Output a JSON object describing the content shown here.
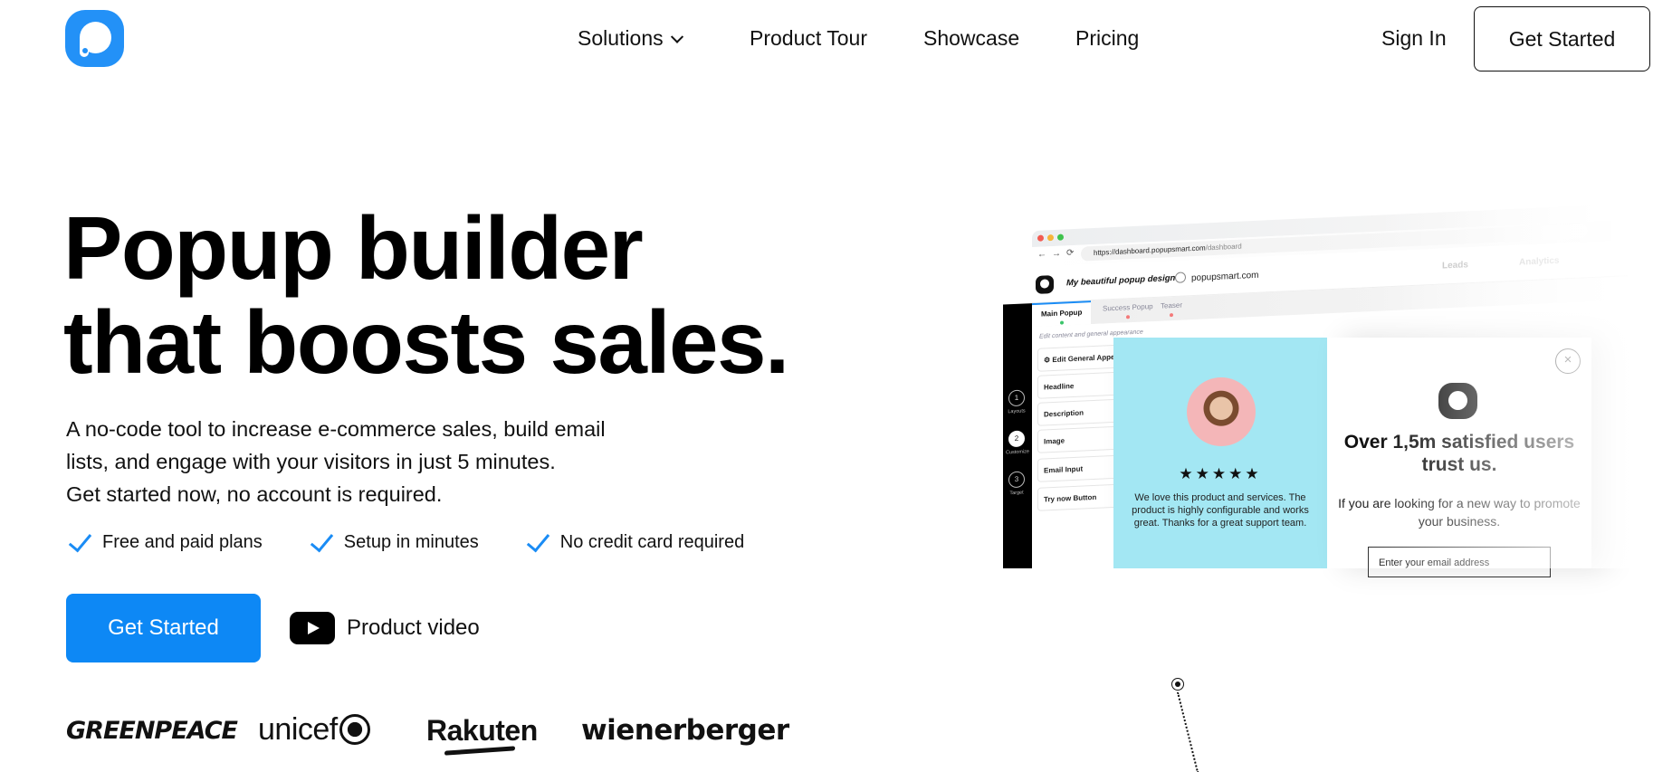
{
  "header": {
    "logo_alt": "Popupsmart",
    "nav": [
      {
        "label": "Solutions",
        "has_dropdown": true
      },
      {
        "label": "Product Tour"
      },
      {
        "label": "Showcase"
      },
      {
        "label": "Pricing"
      }
    ],
    "sign_in": "Sign In",
    "get_started": "Get Started"
  },
  "hero": {
    "headline_line1": "Popup builder",
    "headline_line2": "that boosts sales.",
    "sub_line1": "A no-code tool to increase e-commerce sales, build email",
    "sub_line2": "lists, and engage with your visitors in just 5 minutes.",
    "sub_line3": "Get started now, no account is required.",
    "checks": [
      "Free and paid plans",
      "Setup in minutes",
      "No credit card required"
    ],
    "cta_primary": "Get Started",
    "cta_video": "Product video",
    "accent_color": "#0d88f5"
  },
  "brands": [
    "GREENPEACE",
    "unicef",
    "Rakuten",
    "wienerberger"
  ],
  "mockup": {
    "url_main": "https://dashboard.popupsmart.com",
    "url_rest": "/dashboard",
    "design_title": "My beautiful popup design",
    "site": "popupsmart.com",
    "header_links": [
      "Leads",
      "Analytics"
    ],
    "tabs": [
      {
        "label": "Main Popup",
        "dot": "#3bc46a"
      },
      {
        "label": "Success Popup",
        "dot": "#f47a7a"
      },
      {
        "label": "Teaser",
        "dot": "#f47a7a"
      }
    ],
    "steps": [
      {
        "num": "1",
        "label": "Layouts"
      },
      {
        "num": "2",
        "label": "Customize"
      },
      {
        "num": "3",
        "label": "Target"
      }
    ],
    "editor_hint": "Edit content and general appearance",
    "fields": [
      "Edit General Appearance",
      "Headline",
      "Description",
      "Image",
      "Email Input",
      "Try now Button"
    ],
    "popup": {
      "stars": "★★★★★",
      "rating": 5,
      "testimonial": "We love this product and services. The product is highly configurable and works great. Thanks for a great support team.",
      "title": "Over 1,5m satisfied users trust us.",
      "description": "If you are looking for a new way to promote your business.",
      "email_placeholder": "Enter your email address",
      "close": "×",
      "left_bg": "#a3e7f3"
    }
  }
}
